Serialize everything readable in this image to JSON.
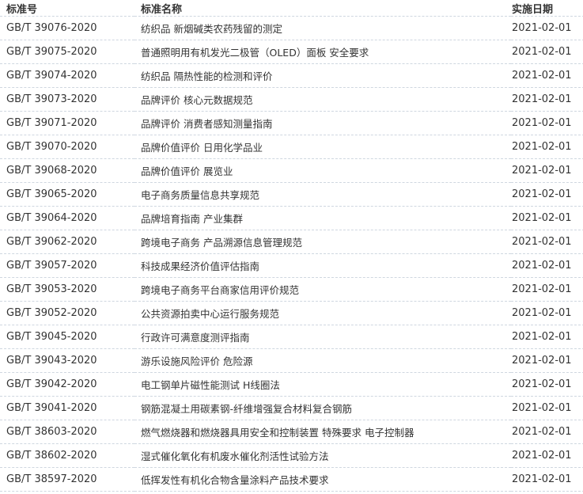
{
  "headers": {
    "code": "标准号",
    "name": "标准名称",
    "date": "实施日期"
  },
  "rows": [
    {
      "code": "GB/T 39076-2020",
      "name": "纺织品 新烟碱类农药残留的测定",
      "date": "2021-02-01"
    },
    {
      "code": "GB/T 39075-2020",
      "name": "普通照明用有机发光二极管（OLED）面板 安全要求",
      "date": "2021-02-01"
    },
    {
      "code": "GB/T 39074-2020",
      "name": "纺织品 隔热性能的检测和评价",
      "date": "2021-02-01"
    },
    {
      "code": "GB/T 39073-2020",
      "name": "品牌评价 核心元数据规范",
      "date": "2021-02-01"
    },
    {
      "code": "GB/T 39071-2020",
      "name": "品牌评价 消费者感知测量指南",
      "date": "2021-02-01"
    },
    {
      "code": "GB/T 39070-2020",
      "name": "品牌价值评价 日用化学品业",
      "date": "2021-02-01"
    },
    {
      "code": "GB/T 39068-2020",
      "name": "品牌价值评价 展览业",
      "date": "2021-02-01"
    },
    {
      "code": "GB/T 39065-2020",
      "name": "电子商务质量信息共享规范",
      "date": "2021-02-01"
    },
    {
      "code": "GB/T 39064-2020",
      "name": "品牌培育指南 产业集群",
      "date": "2021-02-01"
    },
    {
      "code": "GB/T 39062-2020",
      "name": "跨境电子商务 产品溯源信息管理规范",
      "date": "2021-02-01"
    },
    {
      "code": "GB/T 39057-2020",
      "name": "科技成果经济价值评估指南",
      "date": "2021-02-01"
    },
    {
      "code": "GB/T 39053-2020",
      "name": "跨境电子商务平台商家信用评价规范",
      "date": "2021-02-01"
    },
    {
      "code": "GB/T 39052-2020",
      "name": "公共资源拍卖中心运行服务规范",
      "date": "2021-02-01"
    },
    {
      "code": "GB/T 39045-2020",
      "name": "行政许可满意度测评指南",
      "date": "2021-02-01"
    },
    {
      "code": "GB/T 39043-2020",
      "name": "游乐设施风险评价 危险源",
      "date": "2021-02-01"
    },
    {
      "code": "GB/T 39042-2020",
      "name": "电工钢单片磁性能测试 H线圈法",
      "date": "2021-02-01"
    },
    {
      "code": "GB/T 39041-2020",
      "name": "钢筋混凝土用碳素钢-纤维增强复合材料复合钢筋",
      "date": "2021-02-01"
    },
    {
      "code": "GB/T 38603-2020",
      "name": "燃气燃烧器和燃烧器具用安全和控制装置 特殊要求 电子控制器",
      "date": "2021-02-01"
    },
    {
      "code": "GB/T 38602-2020",
      "name": "湿式催化氧化有机废水催化剂活性试验方法",
      "date": "2021-02-01"
    },
    {
      "code": "GB/T 38597-2020",
      "name": "低挥发性有机化合物含量涂料产品技术要求",
      "date": "2021-02-01"
    }
  ]
}
